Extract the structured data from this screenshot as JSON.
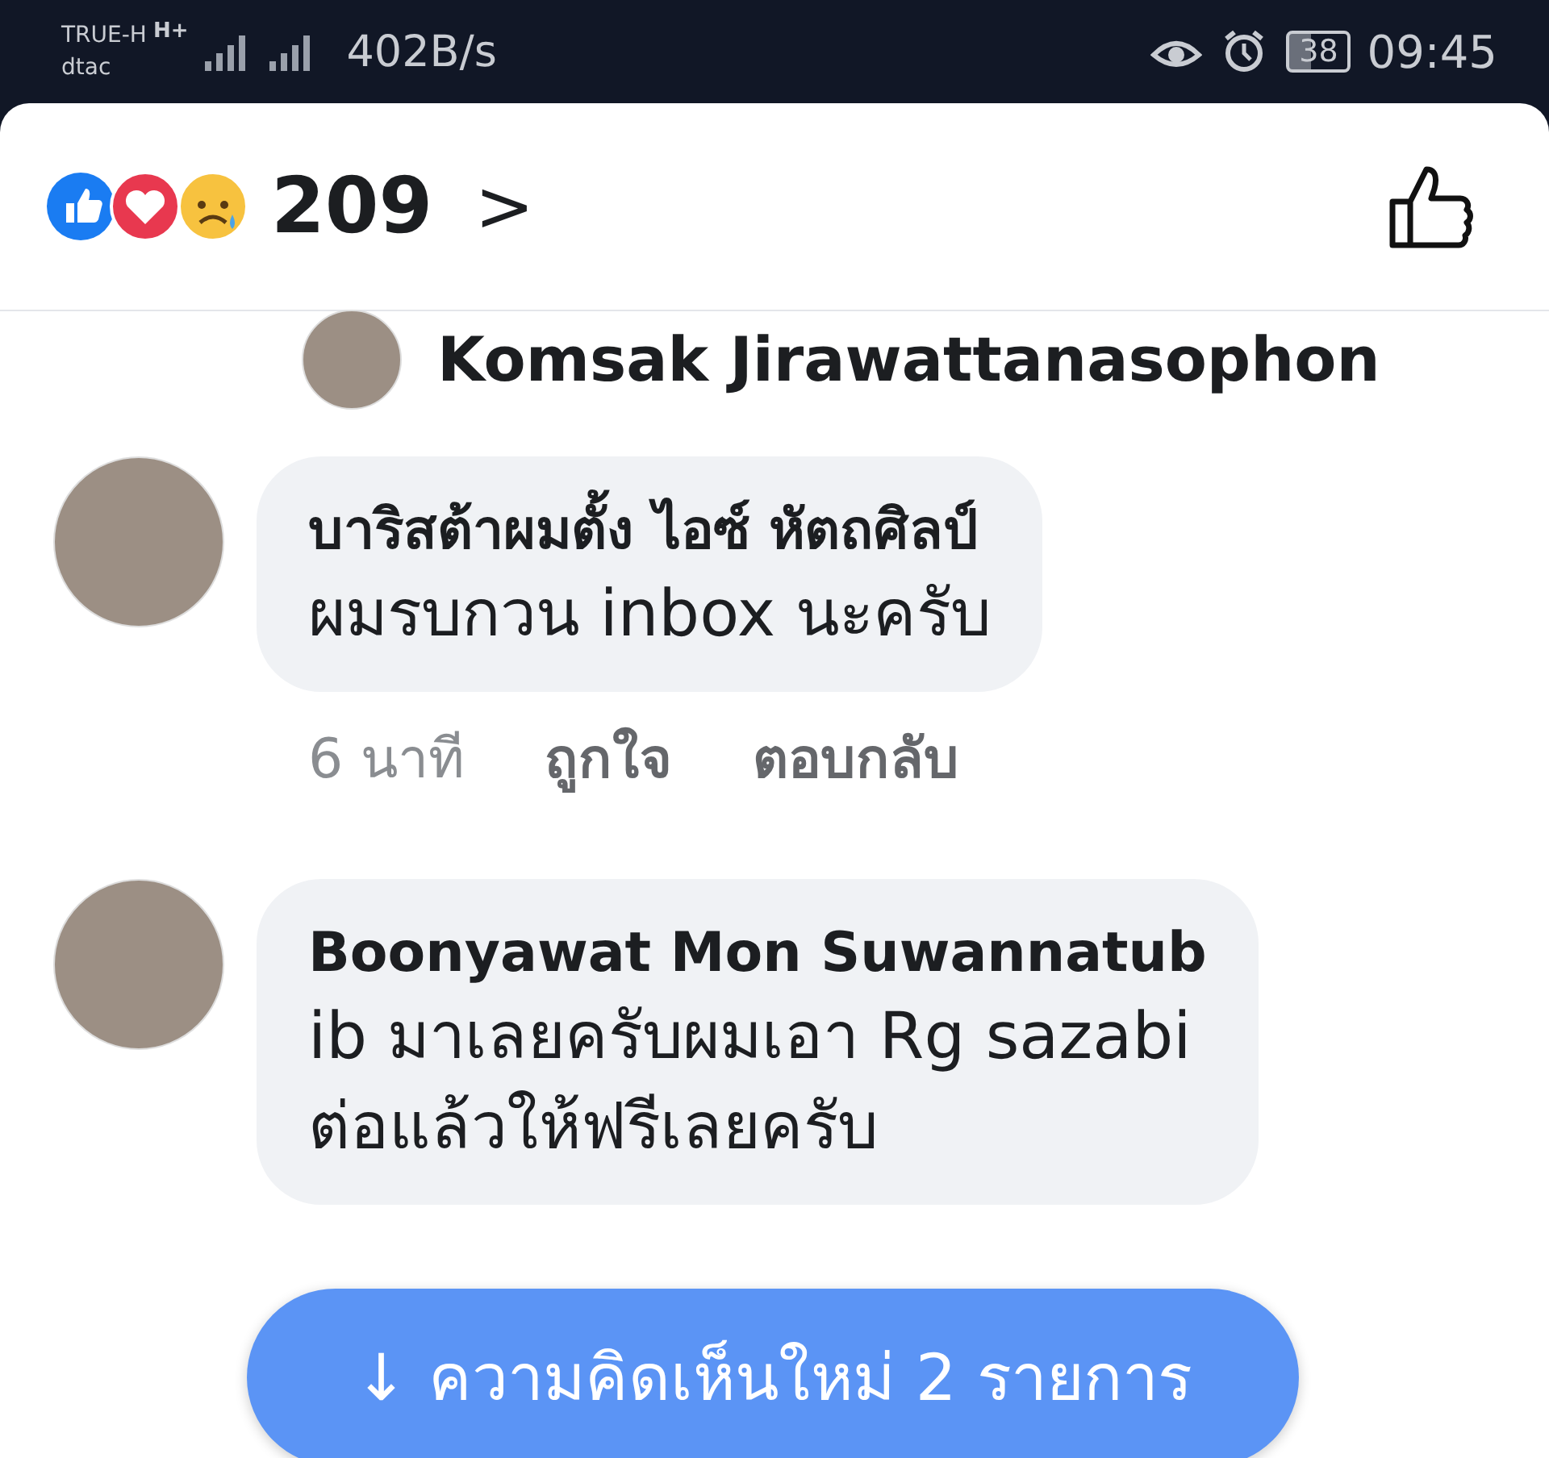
{
  "status_bar": {
    "carrier_1": "TRUE-H",
    "carrier_2": "dtac",
    "network_type": "H+",
    "speed": "402B/s",
    "battery": "38",
    "time": "09:45"
  },
  "reactions": {
    "count": "209",
    "chevron": ">"
  },
  "reply_context": {
    "name": "Komsak Jirawattanasophon"
  },
  "comments": [
    {
      "author": "บาริสต้าผมตั้ง ไอซ์ หัตถศิลป์",
      "text": [
        "ผมรบกวน inbox นะครับ"
      ],
      "time": "6 นาที",
      "like": "ถูกใจ",
      "reply": "ตอบกลับ"
    },
    {
      "author": "Boonyawat Mon Suwannatub",
      "text": [
        "ib มาเลยครับผมเอา Rg sazabi",
        "ต่อแล้วให้ฟรีเลยครับ"
      ]
    }
  ],
  "new_comments_button": "↓ ความคิดเห็นใหม่ 2 รายการ"
}
